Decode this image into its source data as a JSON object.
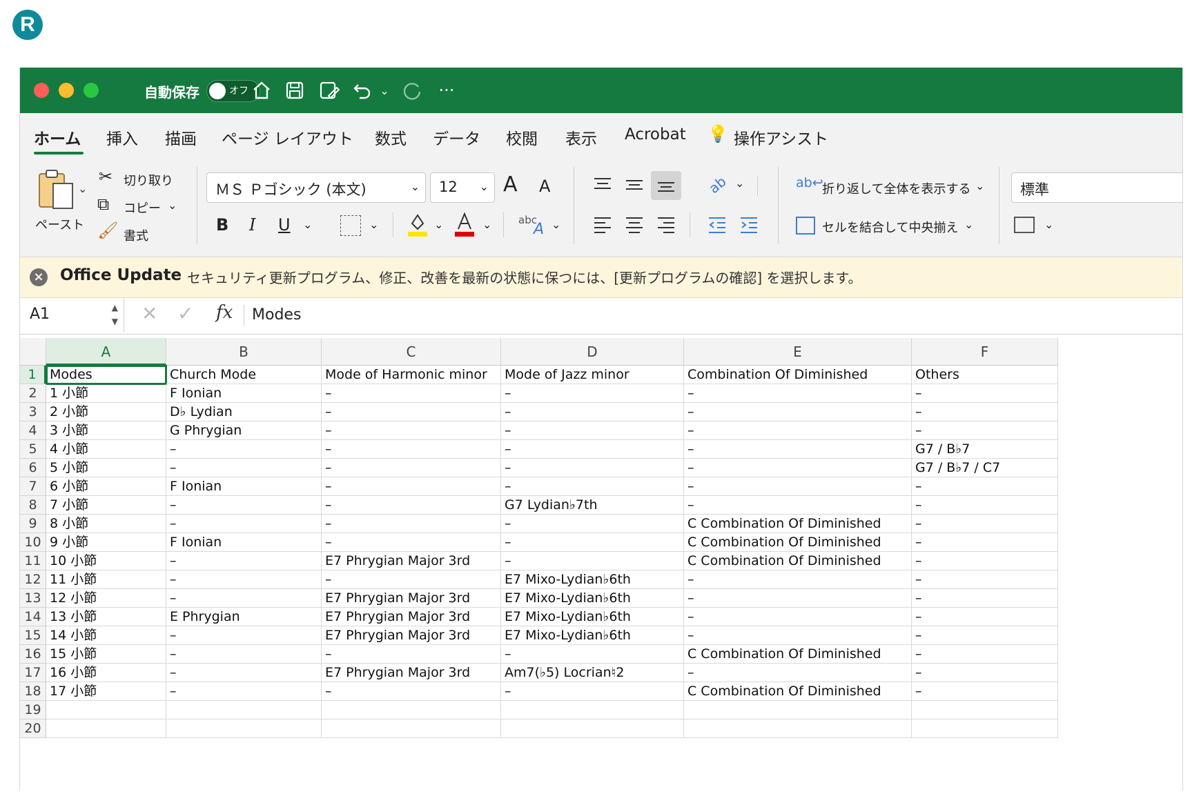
{
  "logo": {
    "letter": "R",
    "color": "#0f8a9b"
  },
  "titlebar": {
    "bg": "#157a3f",
    "autosave_label": "自動保存",
    "toggle_label": "オフ"
  },
  "ribbon": {
    "tabs": [
      "ホーム",
      "挿入",
      "描画",
      "ページ レイアウト",
      "数式",
      "データ",
      "校閲",
      "表示",
      "Acrobat",
      "操作アシスト"
    ],
    "paste_label": "ペースト",
    "cut_label": "切り取り",
    "copy_label": "コピー",
    "format_label": "書式",
    "font_name": "ＭＳ Ｐゴシック (本文)",
    "font_size": "12",
    "wrap_label": "折り返して全体を表示する",
    "merge_label": "セルを結合して中央揃え",
    "number_format": "標準",
    "bold": "B",
    "italic": "I",
    "underline": "U",
    "font_grow": "A",
    "font_shrink": "A",
    "abc": "abc",
    "orientation_abc": "ab"
  },
  "notice": {
    "title": "Office Update",
    "message": "セキュリティ更新プログラム、修正、改善を最新の状態に保つには、[更新プログラムの確認] を選択します。"
  },
  "formula_bar": {
    "name_box": "A1",
    "fx": "fx",
    "value": "Modes"
  },
  "sheet": {
    "columns": [
      "A",
      "B",
      "C",
      "D",
      "E",
      "F"
    ],
    "row_numbers": [
      "1",
      "2",
      "3",
      "4",
      "5",
      "6",
      "7",
      "8",
      "9",
      "10",
      "11",
      "12",
      "13",
      "14",
      "15",
      "16",
      "17",
      "18",
      "19",
      "20"
    ],
    "rows": [
      [
        "Modes",
        "Church Mode",
        "Mode of Harmonic minor",
        "Mode of Jazz minor",
        "Combination Of Diminished",
        "Others"
      ],
      [
        "1 小節",
        "F Ionian",
        "–",
        "–",
        "–",
        "–"
      ],
      [
        "2 小節",
        "D♭ Lydian",
        "–",
        "–",
        "–",
        "–"
      ],
      [
        "3 小節",
        "G Phrygian",
        "–",
        "–",
        "–",
        "–"
      ],
      [
        "4 小節",
        "–",
        "–",
        "–",
        "–",
        "G7 / B♭7"
      ],
      [
        "5 小節",
        "–",
        "–",
        "–",
        "–",
        "G7 / B♭7 / C7"
      ],
      [
        "6 小節",
        "F Ionian",
        "–",
        "–",
        "–",
        "–"
      ],
      [
        "7 小節",
        "–",
        "–",
        "G7 Lydian♭7th",
        "–",
        "–"
      ],
      [
        "8 小節",
        "–",
        "–",
        "–",
        "C Combination Of Diminished",
        "–"
      ],
      [
        "9 小節",
        "F Ionian",
        "–",
        "–",
        "C Combination Of Diminished",
        "–"
      ],
      [
        "10 小節",
        "–",
        "E7 Phrygian Major 3rd",
        "–",
        "C Combination Of Diminished",
        "–"
      ],
      [
        "11 小節",
        "–",
        "–",
        "E7 Mixo-Lydian♭6th",
        "–",
        "–"
      ],
      [
        "12 小節",
        "–",
        "E7 Phrygian Major 3rd",
        "E7 Mixo-Lydian♭6th",
        "–",
        "–"
      ],
      [
        "13 小節",
        "E Phrygian",
        "E7 Phrygian Major 3rd",
        "E7 Mixo-Lydian♭6th",
        "–",
        "–"
      ],
      [
        "14 小節",
        "–",
        "E7 Phrygian Major 3rd",
        "E7 Mixo-Lydian♭6th",
        "–",
        "–"
      ],
      [
        "15 小節",
        "–",
        "–",
        "–",
        "C Combination Of Diminished",
        "–"
      ],
      [
        "16 小節",
        "–",
        "E7 Phrygian Major 3rd",
        "Am7(♭5) Locrian♮2",
        "–",
        "–"
      ],
      [
        "17 小節",
        "–",
        "–",
        "–",
        "C Combination Of Diminished",
        "–"
      ],
      [
        "",
        "",
        "",
        "",
        "",
        ""
      ],
      [
        "",
        "",
        "",
        "",
        "",
        ""
      ]
    ]
  }
}
